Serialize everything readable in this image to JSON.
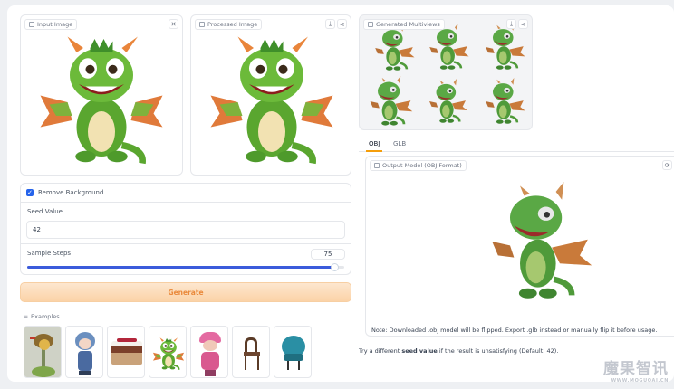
{
  "panels": {
    "input_image": {
      "label": "Input Image"
    },
    "processed_image": {
      "label": "Processed Image"
    },
    "multiviews": {
      "label": "Generated Multiviews"
    }
  },
  "settings": {
    "remove_bg_label": "Remove Background",
    "remove_bg_checked": true,
    "seed_label": "Seed Value",
    "seed_value": "42",
    "steps_label": "Sample Steps",
    "steps_value": "75",
    "steps_fraction": 0.97
  },
  "generate_label": "Generate",
  "examples": {
    "label": "Examples",
    "items": [
      "bird-on-branch",
      "anime-doll",
      "layered-cake",
      "green-dragon",
      "pink-hat-girl",
      "wooden-chair",
      "teal-armchair"
    ]
  },
  "output": {
    "tabs": [
      "OBJ",
      "GLB"
    ],
    "active_tab": "OBJ",
    "model_label": "Output Model (OBJ Format)",
    "note": "Note: Downloaded .obj model will be flipped. Export .glb instead or manually flip it before usage.",
    "tip_prefix": "Try a different ",
    "tip_bold": "seed value",
    "tip_suffix": " if the result is unsatisfying (Default: 42)."
  },
  "watermark": {
    "text": "魔果智讯",
    "sub": "WWW.MOGUOAI.CN"
  },
  "colors": {
    "accent_orange": "#f59e0b",
    "slider_blue": "#3b5bdb",
    "checkbox_blue": "#2563eb"
  }
}
